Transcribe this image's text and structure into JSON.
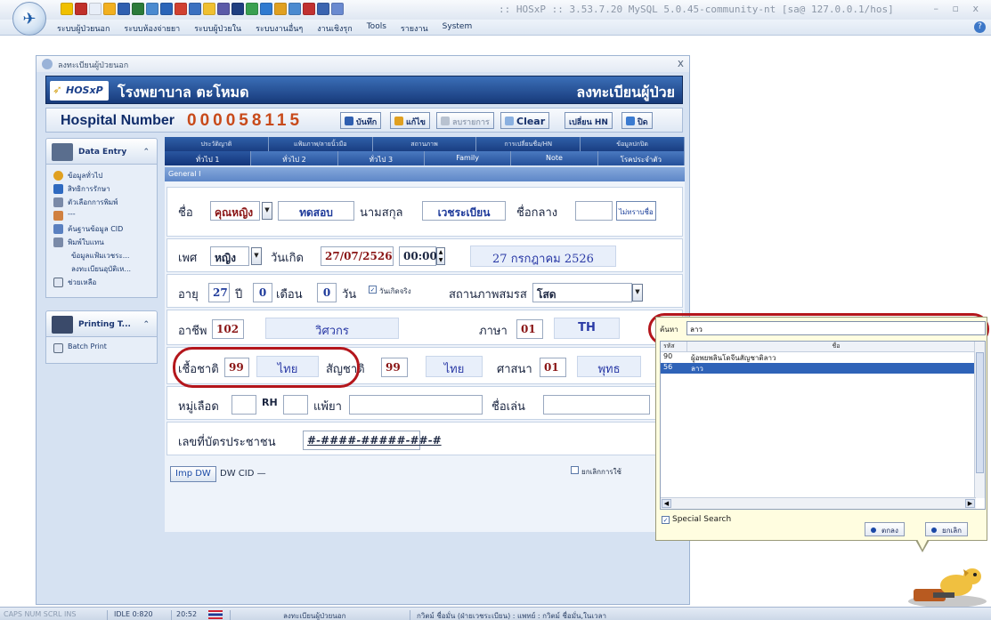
{
  "app": {
    "title": ":: HOSxP :: 3.53.7.20 MySQL 5.0.45-community-nt [sa@ 127.0.0.1/hos]",
    "window_controls": "–  ▫  x"
  },
  "menu": [
    "ระบบผู้ป่วยนอก",
    "ระบบห้องจ่ายยา",
    "ระบบผู้ป่วยใน",
    "ระบบงานอื่นๆ",
    "งานเชิงรุก",
    "Tools",
    "รายงาน",
    "System"
  ],
  "child_window": {
    "title": "ลงทะเบียนผู้ป่วยนอก",
    "close": "x"
  },
  "banner": {
    "logo": "HOSxP",
    "hospital": "โรงพยาบาล ตะโหมด",
    "register": "ลงทะเบียนผู้ป่วย"
  },
  "hn_bar": {
    "label": "Hospital Number",
    "number": "000058115",
    "buttons": {
      "save": "บันทึก",
      "edit": "แก้ไข",
      "cancel_list": "ลบรายการ",
      "clear": "Clear",
      "change_hn": "เปลี่ยน HN",
      "close": "ปิด"
    }
  },
  "sidebar": {
    "data_entry": {
      "title": "Data Entry",
      "items": [
        "ข้อมูลทั่วไป",
        "สิทธิการรักษา",
        "ตัวเลือกการพิมพ์",
        "---",
        "ค้นฐานข้อมูล CID",
        "พิมพ์ใบแทน",
        "ข้อมูลแฟ้มเวชระ...",
        "ลงทะเบียนอุบัติเห...",
        "ช่วยเหลือ"
      ]
    },
    "printing": {
      "title": "Printing T...",
      "items": [
        "Batch Print"
      ]
    }
  },
  "tabs": {
    "top": [
      "ประวัติญาติ",
      "แฟ้มภาพ/ลายนิ้วมือ",
      "สถานภาพ",
      "การเปลี่ยนชื่อ/HN",
      "ข้อมูลปกปิด"
    ],
    "bottom": [
      "ทั่วไป 1",
      "ทั่วไป 2",
      "ทั่วไป 3",
      "Family",
      "Note",
      "โรคประจำตัว"
    ],
    "active": "ทั่วไป 1"
  },
  "form": {
    "section_header": "General I",
    "name": {
      "label": "ชื่อ",
      "prefix": "คุณหญิง",
      "first_name": "ทดสอบ",
      "last_name_label": "นามสกุล",
      "last_name": "เวชระเบียน",
      "middle_name_label": "ชื่อกลาง",
      "middle_name": "",
      "unknown_name_button": "ไม่ทราบชื่อ"
    },
    "sex": {
      "label": "เพศ",
      "value": "หญิง",
      "birth_label": "วันเกิด",
      "birth_date": "27/07/2526",
      "birth_time": "00:00",
      "birth_text": "27 กรกฎาคม 2526"
    },
    "age": {
      "label": "อายุ",
      "years": "27",
      "years_unit": "ปี",
      "months": "0",
      "months_unit": "เดือน",
      "days": "0",
      "days_unit": "วัน",
      "real_birth_label": "วันเกิดจริง",
      "marital_label": "สถานภาพสมรส",
      "marital_value": "โสด"
    },
    "occupation": {
      "label": "อาชีพ",
      "code": "102",
      "name": "วิศวกร",
      "language_label": "ภาษา",
      "language_code": "01",
      "language_name": "TH"
    },
    "ethnic": {
      "race_label": "เชื้อชาติ",
      "race_code": "99",
      "race_name": "ไทย",
      "nation_label": "สัญชาติ",
      "nation_code": "99",
      "nation_name": "ไทย",
      "religion_label": "ศาสนา",
      "religion_code": "01",
      "religion_name": "พุทธ"
    },
    "blood": {
      "label": "หมู่เลือด",
      "group": "",
      "rh_label": "RH",
      "rh": "",
      "allergy_label": "แพ้ยา",
      "allergy": "",
      "nickname_label": "ชื่อเล่น",
      "nickname": ""
    },
    "cid": {
      "label": "เลขที่บัตรประชาชน",
      "value": "#-####-#####-##-#"
    },
    "bottom": {
      "imp_dw": "Imp DW",
      "dw_cid": "DW CID —",
      "cancel_use": "ยกเลิกการใช้"
    }
  },
  "popup": {
    "search_label": "ค้นหา",
    "search_value": "ลาว",
    "columns": [
      "รหัส",
      "ชื่อ"
    ],
    "rows": [
      {
        "code": "90",
        "name": "ผู้อพยพลินโดจีนสัญชาติลาว"
      },
      {
        "code": "56",
        "name": "ลาว"
      }
    ],
    "selected_code": "56",
    "special_search": "Special Search",
    "ok": "ตกลง",
    "cancel": "ยกเลิก"
  },
  "status_bar": {
    "keys": "CAPS  NUM  SCRL  INS",
    "idle": "IDLE 0:820",
    "time": "20:52",
    "form_name": "ลงทะเบียนผู้ป่วยนอก",
    "user": "กวิตม์  ชื่อมั่น (ฝ่ายเวชระเบียน) : แพทย์ : กวิตม์  ชื่อมั่น,ในเวลา"
  },
  "colors": {
    "banner": "#173a7a",
    "hn_number": "#c84a1a",
    "highlight_oval": "#b4161c",
    "selected_row": "#2f63b8"
  }
}
